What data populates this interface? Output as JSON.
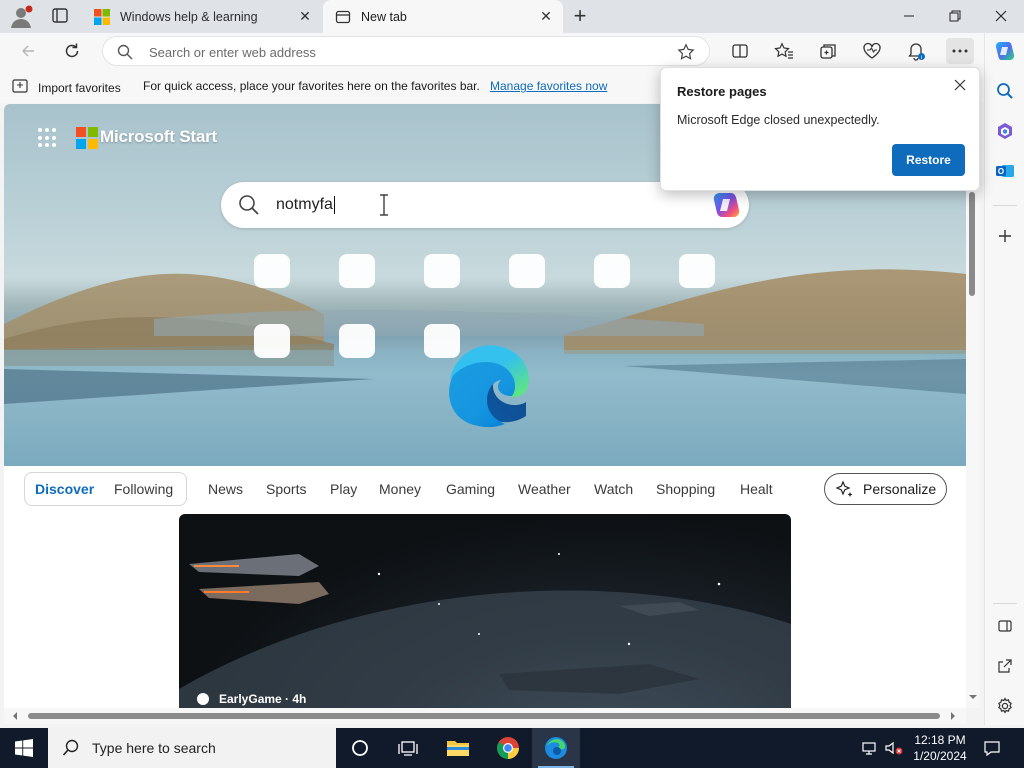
{
  "tabs": [
    {
      "label": "Windows help & learning",
      "active": false
    },
    {
      "label": "New tab",
      "active": true
    }
  ],
  "address_bar": {
    "placeholder": "Search or enter web address"
  },
  "favorites_bar": {
    "import_label": "Import favorites",
    "message": "For quick access, place your favorites here on the favorites bar.",
    "link": "Manage favorites now"
  },
  "popup": {
    "title": "Restore pages",
    "message": "Microsoft Edge closed unexpectedly.",
    "button": "Restore"
  },
  "new_tab_page": {
    "brand": "Microsoft Start",
    "search_value": "notmyfa"
  },
  "news_nav": {
    "items": [
      "Discover",
      "Following",
      "News",
      "Sports",
      "Play",
      "Money",
      "Gaming",
      "Weather",
      "Watch",
      "Shopping",
      "Healt"
    ],
    "active": "Discover",
    "personalize_label": "Personalize"
  },
  "feed": {
    "card_source": "EarlyGame · 4h"
  },
  "taskbar": {
    "search_placeholder": "Type here to search",
    "time": "12:18 PM",
    "date": "1/20/2024"
  },
  "colors": {
    "accent": "#0f6cbd",
    "taskbar": "#101a2a"
  }
}
